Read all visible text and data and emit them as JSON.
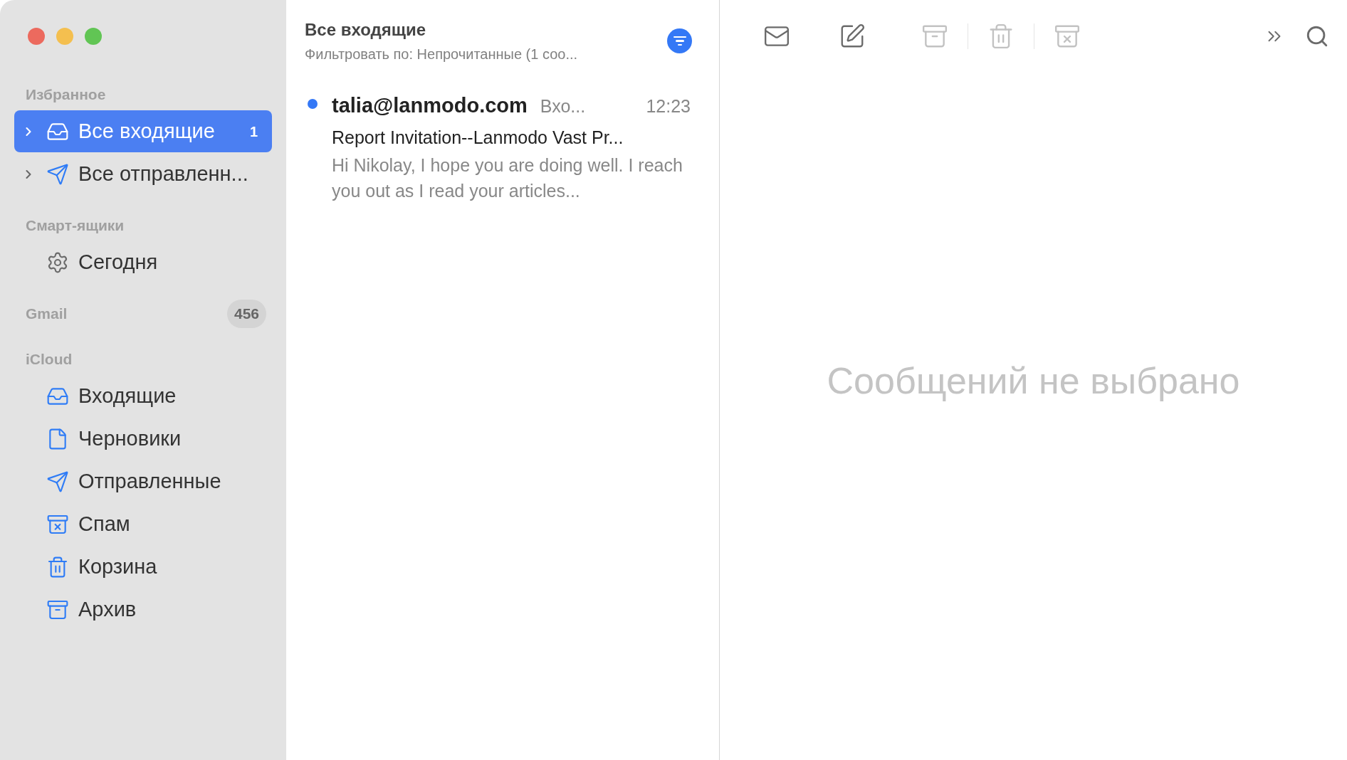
{
  "window": {
    "controls": [
      {
        "color": "#ec6a5e"
      },
      {
        "color": "#f4bf4f"
      },
      {
        "color": "#61c554"
      }
    ]
  },
  "sidebar": {
    "sections": [
      {
        "title": "Избранное",
        "items": [
          {
            "kind": "inbox",
            "label": "Все входящие",
            "count": "1",
            "expanded": false,
            "selected": true
          },
          {
            "kind": "sent",
            "label": "Все отправленн...",
            "expanded": false,
            "selected": false
          }
        ]
      },
      {
        "title": "Смарт-ящики",
        "items": [
          {
            "kind": "smart",
            "label": "Сегодня",
            "selected": false
          }
        ]
      },
      {
        "title": "Gmail",
        "badge": "456"
      },
      {
        "title": "iCloud",
        "items": [
          {
            "kind": "inbox",
            "label": "Входящие",
            "selected": false
          },
          {
            "kind": "drafts",
            "label": "Черновики",
            "selected": false
          },
          {
            "kind": "sent",
            "label": "Отправленные",
            "selected": false
          },
          {
            "kind": "junk",
            "label": "Спам",
            "selected": false
          },
          {
            "kind": "trash",
            "label": "Корзина",
            "selected": false
          },
          {
            "kind": "archive",
            "label": "Архив",
            "selected": false
          }
        ]
      }
    ]
  },
  "message_list": {
    "title": "Все входящие",
    "filter": "Фильтровать по: Непрочитанные (1 соо...",
    "filter_on": true,
    "messages": [
      {
        "sender": "talia@lanmodo.com",
        "mailbox": "Вхо...",
        "time": "12:23",
        "subject": "Report Invitation--Lanmodo Vast Pr...",
        "preview": "Hi Nikolay, I hope you are doing well. I reach you out as I read your articles...",
        "unread": true
      }
    ]
  },
  "toolbar": {
    "buttons": [
      {
        "kind": "get-mail",
        "disabled": false
      },
      {
        "kind": "compose",
        "disabled": false
      },
      {
        "kind": "archive",
        "disabled": true
      },
      {
        "kind": "trash",
        "disabled": true
      },
      {
        "kind": "junk",
        "disabled": true
      }
    ],
    "more": true,
    "search": true
  },
  "reading_pane": {
    "empty_text": "Сообщений не выбрано"
  }
}
